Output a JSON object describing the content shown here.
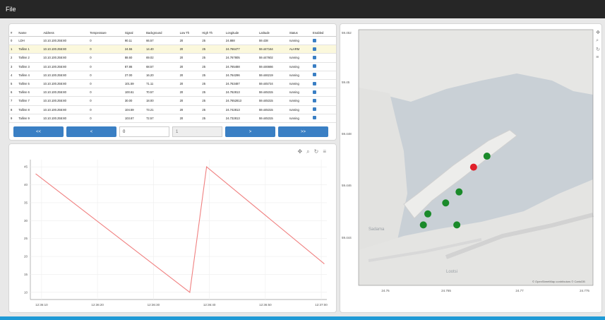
{
  "menu": {
    "file_label": "File"
  },
  "table": {
    "columns": [
      "#",
      "Name",
      "Address",
      "Temperature",
      "Signal",
      "Background",
      "Low Th",
      "High Th",
      "Longitude",
      "Latitude",
      "Status",
      "Enabled"
    ],
    "rows": [
      [
        "0",
        "LDH",
        "10.10.100.255:80",
        "0",
        "90.11",
        "66.57",
        "20",
        "25",
        "24.888",
        "59.438",
        "running",
        ""
      ],
      [
        "1",
        "Tallinn 1",
        "10.10.100.255:80",
        "0",
        "24.55",
        "14.40",
        "20",
        "25",
        "24.766477",
        "59.447164",
        "ALARM",
        ""
      ],
      [
        "2",
        "Tallinn 2",
        "10.10.100.255:80",
        "0",
        "88.60",
        "69.02",
        "20",
        "25",
        "24.767805",
        "59.447602",
        "running",
        ""
      ],
      [
        "3",
        "Tallinn 3",
        "10.10.100.255:80",
        "0",
        "87.86",
        "68.57",
        "20",
        "25",
        "24.765488",
        "59.446666",
        "running",
        ""
      ],
      [
        "4",
        "Tallinn 4",
        "10.10.100.255:80",
        "0",
        "27.00",
        "16.20",
        "20",
        "25",
        "24.764296",
        "59.446219",
        "running",
        ""
      ],
      [
        "5",
        "Tallinn 5",
        "10.10.100.255:80",
        "0",
        "101.59",
        "71.11",
        "20",
        "25",
        "24.763487",
        "59.445724",
        "running",
        ""
      ],
      [
        "6",
        "Tallinn 6",
        "10.10.100.255:80",
        "0",
        "100.61",
        "70.57",
        "20",
        "25",
        "24.762813",
        "59.445315",
        "running",
        ""
      ],
      [
        "7",
        "Tallinn 7",
        "10.10.100.255:80",
        "0",
        "30.00",
        "18.00",
        "20",
        "25",
        "24.7652813",
        "59.445315",
        "running",
        ""
      ],
      [
        "8",
        "Tallinn 8",
        "10.10.100.255:80",
        "0",
        "104.59",
        "73.21",
        "20",
        "25",
        "24.742813",
        "59.445315",
        "running",
        ""
      ],
      [
        "9",
        "Tallinn 9",
        "10.10.100.255:80",
        "0",
        "103.67",
        "72.57",
        "20",
        "25",
        "24.732813",
        "59.445315",
        "running",
        ""
      ]
    ]
  },
  "pager": {
    "first_label": "<<",
    "prev_label": "<",
    "page_value": "0",
    "total_value": "1",
    "next_label": ">",
    "last_label": ">>"
  },
  "chart_toolbar": {
    "pan": "✥",
    "zoom": "⌕",
    "reset": "↻",
    "save": "≡"
  },
  "map_toolbar": {
    "pan": "✥",
    "zoom": "⌕",
    "reset": "↻",
    "save": "≡"
  },
  "chart_data": {
    "type": "line",
    "x": [
      0,
      2.75,
      3.05,
      5.15
    ],
    "y": [
      43,
      10,
      45,
      18
    ],
    "xlim": [
      -0.1,
      5.2
    ],
    "ylim": [
      8,
      47
    ],
    "yticks": [
      10,
      15,
      20,
      25,
      30,
      35,
      40,
      45
    ],
    "xtick_positions": [
      0.1,
      1.1,
      2.1,
      3.1,
      4.1,
      5.1
    ],
    "xtick_labels": [
      "12:36:10",
      "12:36:20",
      "12:36:30",
      "12:36:40",
      "12:36:50",
      "12:37:00"
    ],
    "line_color": "#f08080",
    "grid": true
  },
  "map": {
    "y_ticks": [
      "59.452",
      "59.45",
      "59.448",
      "59.446",
      "59.444"
    ],
    "x_ticks": [
      "24.76",
      "24.765",
      "24.77",
      "24.775"
    ],
    "place_labels": [
      "Sadama",
      "Lootsi"
    ],
    "attribution": "© OpenStreetMap contributors © CartoDB",
    "marker_color_ok": "#1a8a2a",
    "marker_color_alarm": "#e0202a",
    "markers": [
      {
        "lon": 24.7685,
        "lat": 59.4479,
        "status": "running"
      },
      {
        "lon": 24.7673,
        "lat": 59.4475,
        "status": "ALARM"
      },
      {
        "lon": 24.766,
        "lat": 59.4466,
        "status": "running"
      },
      {
        "lon": 24.7648,
        "lat": 59.4462,
        "status": "running"
      },
      {
        "lon": 24.7632,
        "lat": 59.4458,
        "status": "running"
      },
      {
        "lon": 24.7628,
        "lat": 59.4454,
        "status": "running"
      },
      {
        "lon": 24.7658,
        "lat": 59.4454,
        "status": "running"
      }
    ],
    "lon_range": [
      24.757,
      24.778
    ],
    "lat_range": [
      59.4432,
      59.4525
    ]
  }
}
